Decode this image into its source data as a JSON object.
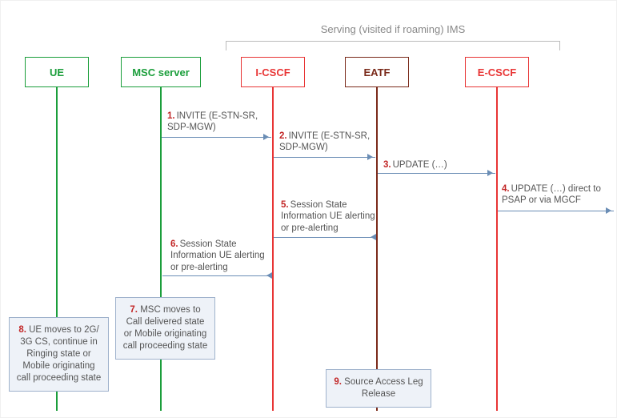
{
  "group_label": "Serving (visited if roaming) IMS",
  "actors": {
    "ue": {
      "label": "UE"
    },
    "msc": {
      "label": "MSC server"
    },
    "icscf": {
      "label": "I-CSCF"
    },
    "eatf": {
      "label": "EATF"
    },
    "ecscf": {
      "label": "E-CSCF"
    }
  },
  "messages": {
    "m1": {
      "num": "1.",
      "text": "INVITE (E-STN-SR, SDP-MGW)"
    },
    "m2": {
      "num": "2.",
      "text": "INVITE (E-STN-SR, SDP-MGW)"
    },
    "m3": {
      "num": "3.",
      "text": "UPDATE (…)"
    },
    "m4": {
      "num": "4.",
      "text": "UPDATE  (…) direct to PSAP or via MGCF"
    },
    "m5": {
      "num": "5.",
      "text": "Session State Information UE alerting or pre-alerting"
    },
    "m6": {
      "num": "6.",
      "text": "Session State Information UE alerting or pre-alerting"
    }
  },
  "notes": {
    "n7": {
      "num": "7.",
      "text": "MSC moves to Call delivered state or Mobile originating call proceeding state"
    },
    "n8": {
      "num": "8.",
      "text": "UE moves to 2G/ 3G CS, continue in Ringing state or Mobile originating call proceeding state"
    },
    "n9": {
      "num": "9.",
      "text": "Source Access Leg Release"
    }
  },
  "chart_data": {
    "type": "table",
    "description": "UML-style sequence diagram of SRVCC emergency session transfer signalling",
    "actors": [
      "UE",
      "MSC server",
      "I-CSCF",
      "EATF",
      "E-CSCF",
      "(external PSAP/MGCF)"
    ],
    "group": {
      "label": "Serving (visited if roaming) IMS",
      "members": [
        "I-CSCF",
        "EATF",
        "E-CSCF"
      ]
    },
    "steps": [
      {
        "step": 1,
        "from": "MSC server",
        "to": "I-CSCF",
        "label": "INVITE (E-STN-SR, SDP-MGW)"
      },
      {
        "step": 2,
        "from": "I-CSCF",
        "to": "EATF",
        "label": "INVITE (E-STN-SR, SDP-MGW)"
      },
      {
        "step": 3,
        "from": "EATF",
        "to": "E-CSCF",
        "label": "UPDATE (…)"
      },
      {
        "step": 4,
        "from": "E-CSCF",
        "to": "(external PSAP/MGCF)",
        "label": "UPDATE (…) direct to PSAP or via MGCF"
      },
      {
        "step": 5,
        "from": "EATF",
        "to": "I-CSCF",
        "label": "Session State Information UE alerting or pre-alerting"
      },
      {
        "step": 6,
        "from": "I-CSCF",
        "to": "MSC server",
        "label": "Session State Information UE alerting or pre-alerting"
      },
      {
        "step": 7,
        "at": "MSC server",
        "note": "MSC moves to Call delivered state or Mobile originating call proceeding state"
      },
      {
        "step": 8,
        "at": "UE",
        "note": "UE moves to 2G/3G CS, continue in Ringing state or Mobile originating call proceeding state"
      },
      {
        "step": 9,
        "at": "EATF",
        "note": "Source Access Leg Release"
      }
    ]
  }
}
